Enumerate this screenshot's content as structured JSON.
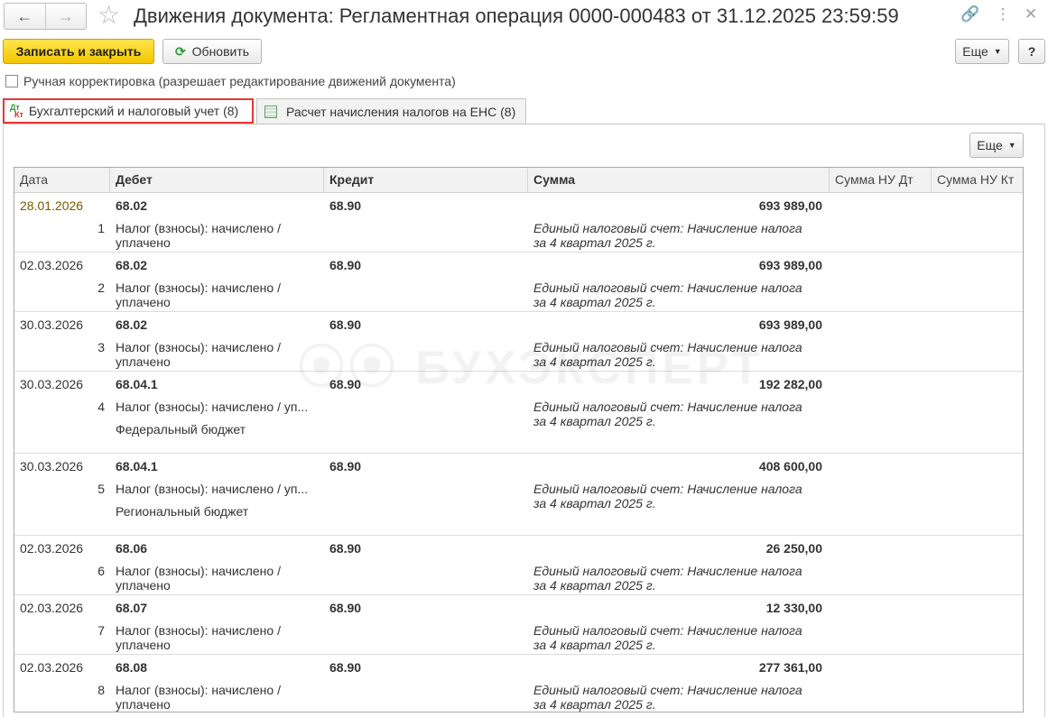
{
  "window": {
    "title": "Движения документа: Регламентная операция 0000-000483 от 31.12.2025 23:59:59"
  },
  "toolbar": {
    "save_close_label": "Записать и закрыть",
    "refresh_label": "Обновить",
    "more_label": "Еще",
    "help_label": "?"
  },
  "manual_edit_label": "Ручная корректировка (разрешает редактирование движений документа)",
  "tabs": [
    {
      "label": "Бухгалтерский и налоговый учет (8)"
    },
    {
      "label": "Расчет начисления налогов на ЕНС (8)"
    }
  ],
  "table": {
    "more_label": "Еще",
    "columns": [
      "Дата",
      "Дебет",
      "Кредит",
      "Сумма",
      "Сумма НУ Дт",
      "Сумма НУ Кт"
    ],
    "rows": [
      {
        "date": "28.01.2026",
        "n": "1",
        "debit": "68.02",
        "debit_desc": "Налог (взносы): начислено / уплачено",
        "debit_sub": "",
        "credit": "68.90",
        "sum": "693 989,00",
        "content": "Единый налоговый счет: Начисление налога за 4 квартал 2025 г."
      },
      {
        "date": "02.03.2026",
        "n": "2",
        "debit": "68.02",
        "debit_desc": "Налог (взносы): начислено / уплачено",
        "debit_sub": "",
        "credit": "68.90",
        "sum": "693 989,00",
        "content": "Единый налоговый счет: Начисление налога за 4 квартал 2025 г."
      },
      {
        "date": "30.03.2026",
        "n": "3",
        "debit": "68.02",
        "debit_desc": "Налог (взносы): начислено / уплачено",
        "debit_sub": "",
        "credit": "68.90",
        "sum": "693 989,00",
        "content": "Единый налоговый счет: Начисление налога за 4 квартал 2025 г."
      },
      {
        "date": "30.03.2026",
        "n": "4",
        "debit": "68.04.1",
        "debit_desc": "Налог (взносы): начислено / уп...",
        "debit_sub": "Федеральный бюджет",
        "credit": "68.90",
        "sum": "192 282,00",
        "content": "Единый налоговый счет: Начисление налога за 4 квартал 2025 г."
      },
      {
        "date": "30.03.2026",
        "n": "5",
        "debit": "68.04.1",
        "debit_desc": "Налог (взносы): начислено / уп...",
        "debit_sub": "Региональный бюджет",
        "credit": "68.90",
        "sum": "408 600,00",
        "content": "Единый налоговый счет: Начисление налога за 4 квартал 2025 г."
      },
      {
        "date": "02.03.2026",
        "n": "6",
        "debit": "68.06",
        "debit_desc": "Налог (взносы): начислено / уплачено",
        "debit_sub": "",
        "credit": "68.90",
        "sum": "26 250,00",
        "content": "Единый налоговый счет: Начисление налога за 4 квартал 2025 г."
      },
      {
        "date": "02.03.2026",
        "n": "7",
        "debit": "68.07",
        "debit_desc": "Налог (взносы): начислено / уплачено",
        "debit_sub": "",
        "credit": "68.90",
        "sum": "12 330,00",
        "content": "Единый налоговый счет: Начисление налога за 4 квартал 2025 г."
      },
      {
        "date": "02.03.2026",
        "n": "8",
        "debit": "68.08",
        "debit_desc": "Налог (взносы): начислено / уплачено",
        "debit_sub": "",
        "credit": "68.90",
        "sum": "277 361,00",
        "content": "Единый налоговый счет: Начисление налога за 4 квартал 2025 г."
      }
    ]
  },
  "watermark": "БУХЭКСПЕРТ"
}
